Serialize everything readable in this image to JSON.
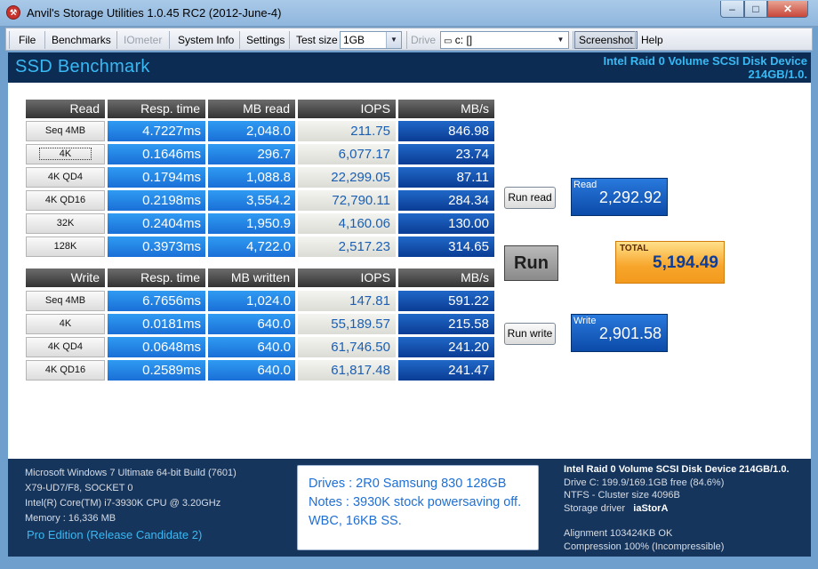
{
  "window": {
    "title": "Anvil's Storage Utilities 1.0.45 RC2 (2012-June-4)",
    "app_icon": "anvil-logo-icon",
    "controls": {
      "minimize": "–",
      "maximize": "□",
      "close": "✕"
    }
  },
  "toolbar": {
    "file": "File",
    "benchmarks": "Benchmarks",
    "iometer": "IOmeter",
    "system_info": "System Info",
    "settings": "Settings",
    "test_size_label": "Test size",
    "test_size_value": "1GB",
    "drive_label": "Drive",
    "drive_value": "c: []",
    "screenshot": "Screenshot",
    "help": "Help"
  },
  "header": {
    "title": "SSD Benchmark",
    "device_line1": "Intel Raid 0 Volume SCSI Disk Device",
    "device_line2": "214GB/1.0."
  },
  "read_table": {
    "headers": [
      "Read",
      "Resp. time",
      "MB read",
      "IOPS",
      "MB/s"
    ],
    "rows": [
      [
        "Seq 4MB",
        "4.7227ms",
        "2,048.0",
        "211.75",
        "846.98"
      ],
      [
        "4K",
        "0.1646ms",
        "296.7",
        "6,077.17",
        "23.74"
      ],
      [
        "4K QD4",
        "0.1794ms",
        "1,088.8",
        "22,299.05",
        "87.11"
      ],
      [
        "4K QD16",
        "0.2198ms",
        "3,554.2",
        "72,790.11",
        "284.34"
      ],
      [
        "32K",
        "0.2404ms",
        "1,950.9",
        "4,160.06",
        "130.00"
      ],
      [
        "128K",
        "0.3973ms",
        "4,722.0",
        "2,517.23",
        "314.65"
      ]
    ]
  },
  "write_table": {
    "headers": [
      "Write",
      "Resp. time",
      "MB written",
      "IOPS",
      "MB/s"
    ],
    "rows": [
      [
        "Seq 4MB",
        "6.7656ms",
        "1,024.0",
        "147.81",
        "591.22"
      ],
      [
        "4K",
        "0.0181ms",
        "640.0",
        "55,189.57",
        "215.58"
      ],
      [
        "4K QD4",
        "0.0648ms",
        "640.0",
        "61,746.50",
        "241.20"
      ],
      [
        "4K QD16",
        "0.2589ms",
        "640.0",
        "61,817.48",
        "241.47"
      ]
    ]
  },
  "buttons": {
    "run_read": "Run read",
    "run": "Run",
    "run_write": "Run write"
  },
  "scores": {
    "read_label": "Read",
    "read_value": "2,292.92",
    "total_label": "TOTAL",
    "total_value": "5,194.49",
    "write_label": "Write",
    "write_value": "2,901.58"
  },
  "footer": {
    "sysinfo": [
      "Microsoft Windows 7 Ultimate  64-bit Build (7601)",
      "X79-UD7/F8, SOCKET 0",
      "Intel(R) Core(TM) i7-3930K CPU @ 3.20GHz",
      "Memory : 16,336 MB"
    ],
    "edition": "Pro Edition (Release Candidate 2)",
    "notes": [
      "Drives : 2R0 Samsung 830 128GB",
      "Notes : 3930K stock powersaving off.",
      "WBC, 16KB SS."
    ],
    "device": {
      "title": "Intel Raid 0 Volume SCSI Disk Device 214GB/1.0.",
      "drive": "Drive C: 199.9/169.1GB free (84.6%)",
      "ntfs": "NTFS - Cluster size 4096B",
      "storage_driver_label": "Storage driver",
      "storage_driver_value": "iaStorA",
      "alignment": "Alignment 103424KB OK",
      "compression": "Compression 100% (Incompressible)"
    }
  },
  "colors": {
    "header_bg": "#0d2c54",
    "accent_cyan": "#39b9f3",
    "cell_light_blue": "#2f9bf2",
    "cell_dark_blue": "#0a3c94",
    "total_orange": "#f7a52b"
  }
}
